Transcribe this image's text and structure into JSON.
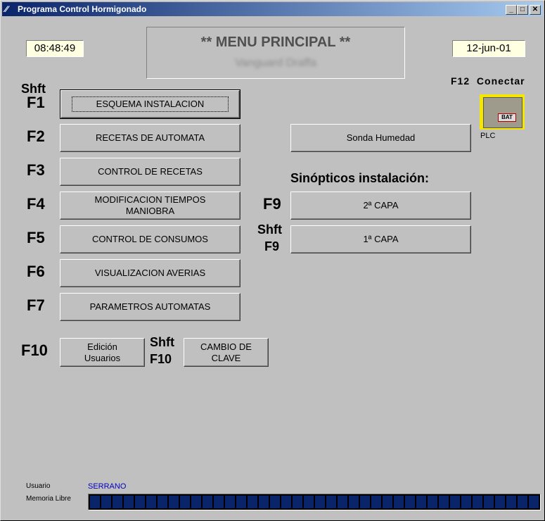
{
  "window": {
    "title": "Programa Control Hormigonado",
    "minimize": "_",
    "maximize": "□",
    "close": "✕"
  },
  "header": {
    "time": "08:48:49",
    "date": "12-jun-01",
    "menu_title": "** MENU PRINCIPAL **",
    "menu_subtitle": "Vanguard Draffa"
  },
  "connect": {
    "label": "F12  Conectar",
    "plc_label": "PLC",
    "plc_badge": "BAT"
  },
  "left_menu": [
    {
      "key_prefix": "Shft",
      "key": "F1",
      "label": "ESQUEMA INSTALACION"
    },
    {
      "key_prefix": "",
      "key": "F2",
      "label": "RECETAS DE AUTOMATA"
    },
    {
      "key_prefix": "",
      "key": "F3",
      "label": "CONTROL DE RECETAS"
    },
    {
      "key_prefix": "",
      "key": "F4",
      "label_line1": "MODIFICACION TIEMPOS",
      "label_line2": "MANIOBRA"
    },
    {
      "key_prefix": "",
      "key": "F5",
      "label": "CONTROL DE CONSUMOS"
    },
    {
      "key_prefix": "",
      "key": "F6",
      "label": "VISUALIZACION AVERIAS"
    },
    {
      "key_prefix": "",
      "key": "F7",
      "label": "PARAMETROS AUTOMATAS"
    }
  ],
  "users": {
    "key": "F10",
    "edit_line1": "Edición",
    "edit_line2": "Usuarios",
    "shift_prefix": "Shft",
    "shift_key": "F10",
    "change_line1": "CAMBIO DE",
    "change_line2": "CLAVE"
  },
  "right_panel": {
    "sonda": "Sonda Humedad",
    "synoptics_title": "Sinópticos instalación:",
    "capa2_key": "F9",
    "capa2_label": "2ª CAPA",
    "capa1_prefix": "Shft",
    "capa1_key": "F9",
    "capa1_label": "1ª CAPA"
  },
  "status": {
    "user_label": "Usuario",
    "user_value": "SERRANO",
    "memory_label": "Memoria Libre",
    "memory_fraction": 1.0
  },
  "colors": {
    "title_bar_start": "#0a246a",
    "field_bg": "#ffffe1",
    "user_value": "#0000c0",
    "memory_segments": "#0a246a",
    "plc_bg": "#f5e800"
  }
}
